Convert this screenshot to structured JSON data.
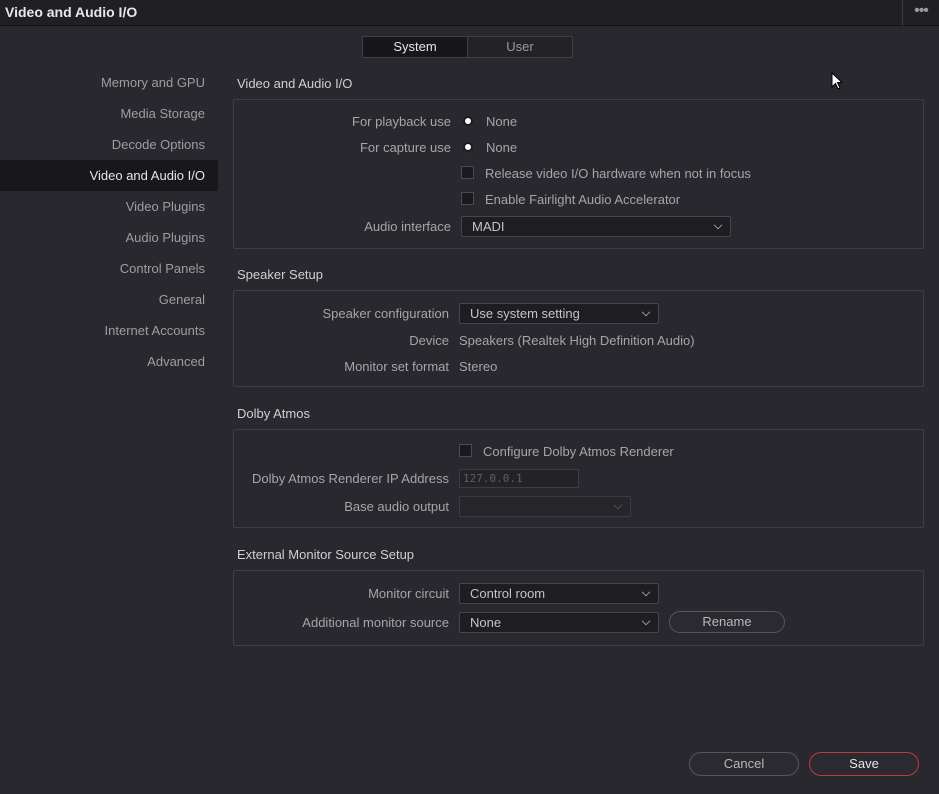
{
  "window": {
    "title": "Video and Audio I/O",
    "more_icon": "ellipsis-icon"
  },
  "tabs": {
    "system": "System",
    "user": "User",
    "active": "System"
  },
  "sidebar": {
    "items": [
      {
        "label": "Memory and GPU"
      },
      {
        "label": "Media Storage"
      },
      {
        "label": "Decode Options"
      },
      {
        "label": "Video and Audio I/O"
      },
      {
        "label": "Video Plugins"
      },
      {
        "label": "Audio Plugins"
      },
      {
        "label": "Control Panels"
      },
      {
        "label": "General"
      },
      {
        "label": "Internet Accounts"
      },
      {
        "label": "Advanced"
      }
    ],
    "selected": "Video and Audio I/O"
  },
  "video_audio_io": {
    "title": "Video and Audio I/O",
    "playback_label": "For playback use",
    "playback_value": "None",
    "capture_label": "For capture use",
    "capture_value": "None",
    "release_label": "Release video I/O hardware when not in focus",
    "fairlight_label": "Enable Fairlight Audio Accelerator",
    "audio_interface_label": "Audio interface",
    "audio_interface_value": "MADI"
  },
  "speaker_setup": {
    "title": "Speaker Setup",
    "config_label": "Speaker configuration",
    "config_value": "Use system setting",
    "device_label": "Device",
    "device_value": "Speakers (Realtek High Definition Audio)",
    "format_label": "Monitor set format",
    "format_value": "Stereo"
  },
  "dolby_atmos": {
    "title": "Dolby Atmos",
    "configure_label": "Configure Dolby Atmos Renderer",
    "ip_label": "Dolby Atmos Renderer IP Address",
    "ip_placeholder": "127.0.0.1",
    "base_output_label": "Base audio output",
    "base_output_value": ""
  },
  "external_monitor": {
    "title": "External Monitor Source Setup",
    "circuit_label": "Monitor circuit",
    "circuit_value": "Control room",
    "additional_label": "Additional monitor source",
    "additional_value": "None",
    "rename_label": "Rename"
  },
  "footer": {
    "cancel_label": "Cancel",
    "save_label": "Save"
  },
  "colors": {
    "accent": "#c0393b",
    "background": "#28282e",
    "selected": "#18181c"
  }
}
